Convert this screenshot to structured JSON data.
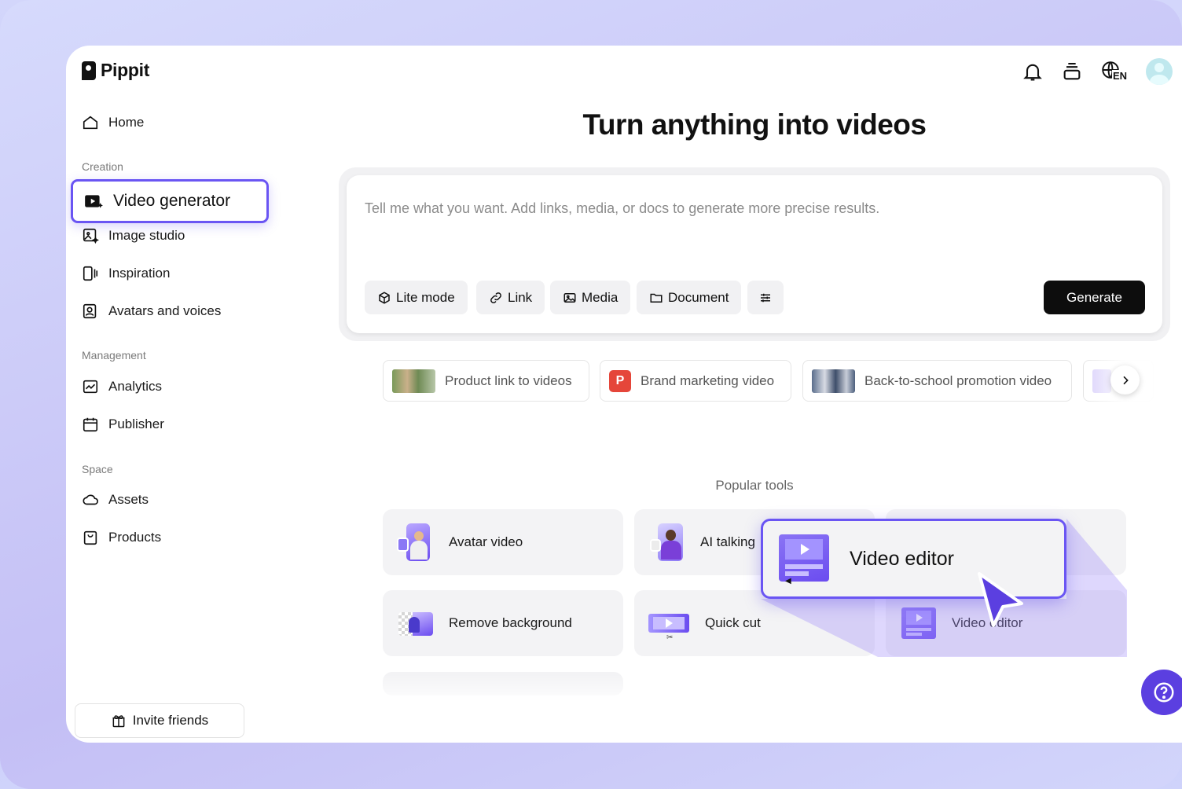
{
  "app": {
    "name": "Pippit"
  },
  "sidebar": {
    "home": "Home",
    "sections": {
      "creation": "Creation",
      "management": "Management",
      "space": "Space"
    },
    "items": [
      {
        "label": "Video generator",
        "icon": "video-sparkle-icon",
        "active": true
      },
      {
        "label": "Image studio",
        "icon": "image-sparkle-icon"
      },
      {
        "label": "Inspiration",
        "icon": "inspiration-icon"
      },
      {
        "label": "Avatars and voices",
        "icon": "avatar-icon"
      },
      {
        "label": "Analytics",
        "icon": "analytics-icon"
      },
      {
        "label": "Publisher",
        "icon": "calendar-icon"
      },
      {
        "label": "Assets",
        "icon": "cloud-icon"
      },
      {
        "label": "Products",
        "icon": "bag-icon"
      }
    ],
    "invite": "Invite friends"
  },
  "topbar": {
    "language": "EN"
  },
  "main": {
    "headline": "Turn anything into videos",
    "prompt_placeholder": "Tell me what you want. Add links, media, or docs to generate more precise results.",
    "chips": [
      "Lite mode",
      "Link",
      "Media",
      "Document"
    ],
    "generate": "Generate",
    "templates": [
      {
        "label": "Product link to videos"
      },
      {
        "label": "Brand marketing video",
        "badge": "P"
      },
      {
        "label": "Back-to-school promotion video"
      }
    ],
    "popular_label": "Popular tools",
    "tools": [
      "Avatar video",
      "AI talking",
      "Remove background",
      "Quick cut",
      "Video editor"
    ],
    "zoom_label": "Video editor"
  },
  "colors": {
    "accent": "#6a55f3",
    "help": "#5b3fe0",
    "generate_bg": "#0d0d0d"
  }
}
